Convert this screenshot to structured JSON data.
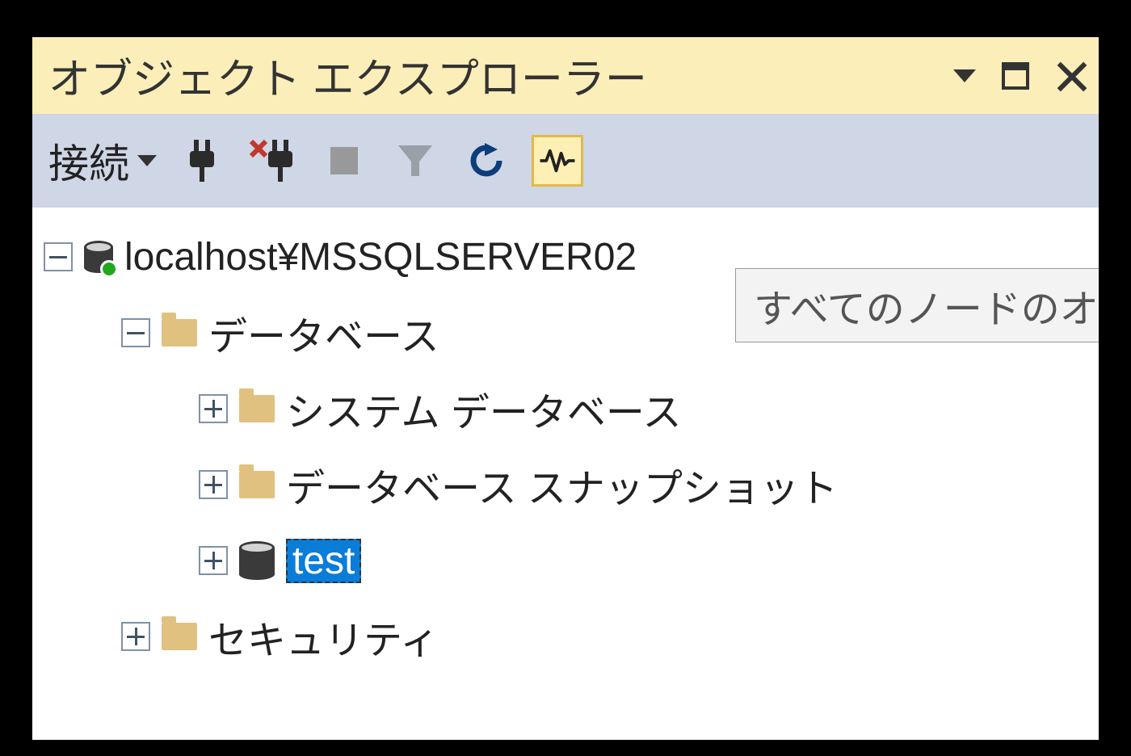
{
  "panel": {
    "title": "オブジェクト エクスプローラー"
  },
  "toolbar": {
    "connect_label": "接続"
  },
  "tooltip": {
    "text": "すべてのノードのオ"
  },
  "tree": {
    "server": "localhost¥MSSQLSERVER02",
    "databases": "データベース",
    "system_db": "システム データベース",
    "db_snapshots": "データベース スナップショット",
    "selected_db": "test",
    "security": "セキュリティ"
  }
}
